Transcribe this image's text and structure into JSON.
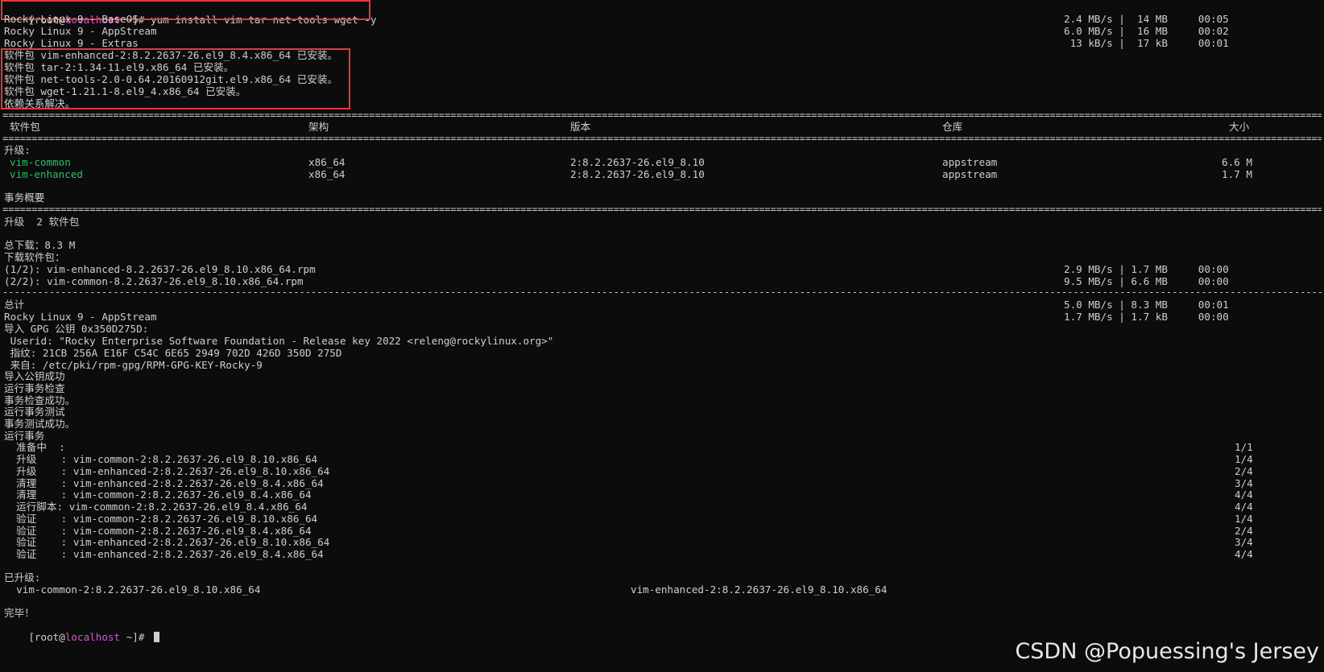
{
  "prompt": {
    "root": "[root@",
    "host": "localhost",
    "path_tail": " ~]# ",
    "command": "yum install vim tar net-tools wget -y"
  },
  "repos": [
    {
      "name": "Rocky Linux 9 - BaseOS",
      "stats": "2.4 MB/s |  14 MB     00:05"
    },
    {
      "name": "Rocky Linux 9 - AppStream",
      "stats": "6.0 MB/s |  16 MB     00:02"
    },
    {
      "name": "Rocky Linux 9 - Extras",
      "stats": " 13 kB/s |  17 kB     00:01"
    }
  ],
  "installed": [
    "软件包 vim-enhanced-2:8.2.2637-26.el9_8.4.x86_64 已安装。",
    "软件包 tar-2:1.34-11.el9.x86_64 已安装。",
    "软件包 net-tools-2.0-0.64.20160912git.el9.x86_64 已安装。",
    "软件包 wget-1.21.1-8.el9_4.x86_64 已安装。",
    "依赖关系解决。"
  ],
  "rule_double": "================================================================================================================================================================================================================================================================",
  "rule_dash": "----------------------------------------------------------------------------------------------------------------------------------------------------------------------------------------------------------------------------------------------------------------",
  "table": {
    "headers": {
      "pkg": "软件包",
      "arch": "架构",
      "ver": "版本",
      "repo": "仓库",
      "size": "大小"
    },
    "section": "升级:",
    "rows": [
      {
        "pkg": "vim-common",
        "arch": "x86_64",
        "ver": "2:8.2.2637-26.el9_8.10",
        "repo": "appstream",
        "size": "6.6 M"
      },
      {
        "pkg": "vim-enhanced",
        "arch": "x86_64",
        "ver": "2:8.2.2637-26.el9_8.10",
        "repo": "appstream",
        "size": "1.7 M"
      }
    ]
  },
  "summary": {
    "title": "事务概要",
    "upgrade": "升级  2 软件包",
    "total_download": "总下载：8.3 M",
    "downloading": "下载软件包："
  },
  "downloads": [
    {
      "name": "(1/2): vim-enhanced-8.2.2637-26.el9_8.10.x86_64.rpm",
      "stats": "2.9 MB/s | 1.7 MB     00:00"
    },
    {
      "name": "(2/2): vim-common-8.2.2637-26.el9_8.10.x86_64.rpm",
      "stats": "9.5 MB/s | 6.6 MB     00:00"
    }
  ],
  "total": {
    "label": "总计",
    "stats": "5.0 MB/s | 8.3 MB     00:01"
  },
  "appstream": {
    "name": "Rocky Linux 9 - AppStream",
    "stats": "1.7 MB/s | 1.7 kB     00:00"
  },
  "gpg": [
    "导入 GPG 公钥 0x350D275D:",
    " Userid: \"Rocky Enterprise Software Foundation - Release key 2022 <releng@rockylinux.org>\"",
    " 指纹: 21CB 256A E16F C54C 6E65 2949 702D 426D 350D 275D",
    " 来自: /etc/pki/rpm-gpg/RPM-GPG-KEY-Rocky-9",
    "导入公钥成功",
    "运行事务检查",
    "事务检查成功。",
    "运行事务测试",
    "事务测试成功。",
    "运行事务"
  ],
  "steps": [
    {
      "text": "  准备中  :",
      "count": "1/1"
    },
    {
      "text": "  升级    : vim-common-2:8.2.2637-26.el9_8.10.x86_64",
      "count": "1/4"
    },
    {
      "text": "  升级    : vim-enhanced-2:8.2.2637-26.el9_8.10.x86_64",
      "count": "2/4"
    },
    {
      "text": "  清理    : vim-enhanced-2:8.2.2637-26.el9_8.4.x86_64",
      "count": "3/4"
    },
    {
      "text": "  清理    : vim-common-2:8.2.2637-26.el9_8.4.x86_64",
      "count": "4/4"
    },
    {
      "text": "  运行脚本: vim-common-2:8.2.2637-26.el9_8.4.x86_64",
      "count": "4/4"
    },
    {
      "text": "  验证    : vim-common-2:8.2.2637-26.el9_8.10.x86_64",
      "count": "1/4"
    },
    {
      "text": "  验证    : vim-common-2:8.2.2637-26.el9_8.4.x86_64",
      "count": "2/4"
    },
    {
      "text": "  验证    : vim-enhanced-2:8.2.2637-26.el9_8.10.x86_64",
      "count": "3/4"
    },
    {
      "text": "  验证    : vim-enhanced-2:8.2.2637-26.el9_8.4.x86_64",
      "count": "4/4"
    }
  ],
  "upgraded": {
    "label": "已升级:",
    "left": "  vim-common-2:8.2.2637-26.el9_8.10.x86_64",
    "right": "vim-enhanced-2:8.2.2637-26.el9_8.10.x86_64"
  },
  "done": "完毕！",
  "watermark": "CSDN @Popuessing's Jersey",
  "colors": {
    "background": "#0c0c0c",
    "text": "#cfcfcf",
    "green": "#23c463",
    "magenta": "#c95ccf",
    "highlight_box": "#e33a3a"
  }
}
